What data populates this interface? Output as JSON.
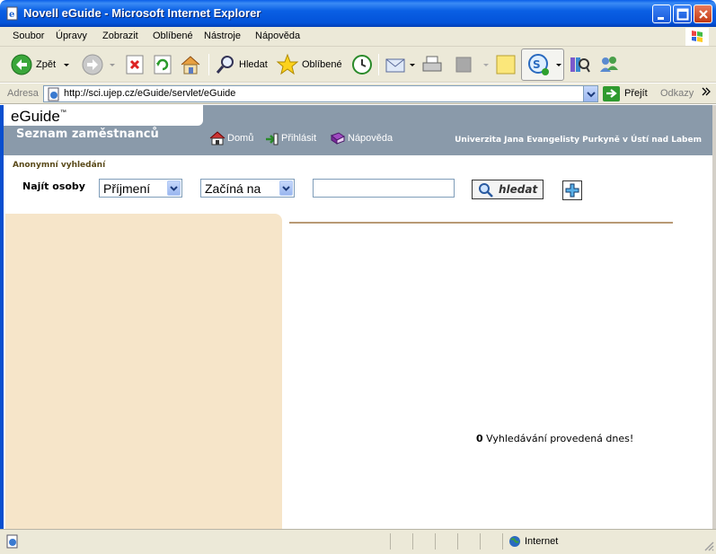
{
  "window": {
    "title": "Novell eGuide - Microsoft Internet Explorer"
  },
  "menu": {
    "items": [
      "Soubor",
      "Úpravy",
      "Zobrazit",
      "Oblíbené",
      "Nástroje",
      "Nápověda"
    ]
  },
  "toolbar": {
    "back_label": "Zpět",
    "search_label": "Hledat",
    "favorites_label": "Oblíbené"
  },
  "address": {
    "label": "Adresa",
    "url": "http://sci.ujep.cz/eGuide/servlet/eGuide",
    "go_label": "Přejít",
    "links_label": "Odkazy"
  },
  "eguide": {
    "logo": "eGuide",
    "logo_tm": "™",
    "subtitle": "Seznam zaměstnanců",
    "nav": {
      "home": "Domů",
      "login": "Přihlásit",
      "help": "Nápověda"
    },
    "university": "Univerzita Jana Evangelisty Purkyně v Ústí nad Labem",
    "anonymous_label": "Anonymní vyhledání",
    "find_label": "Najít osoby",
    "field_select": "Příjmení",
    "condition_select": "Začíná na",
    "search_value": "",
    "search_button": "hledat",
    "stats_count": "0",
    "stats_text": "Vyhledávání provedená dnes!"
  },
  "status": {
    "zone": "Internet"
  }
}
